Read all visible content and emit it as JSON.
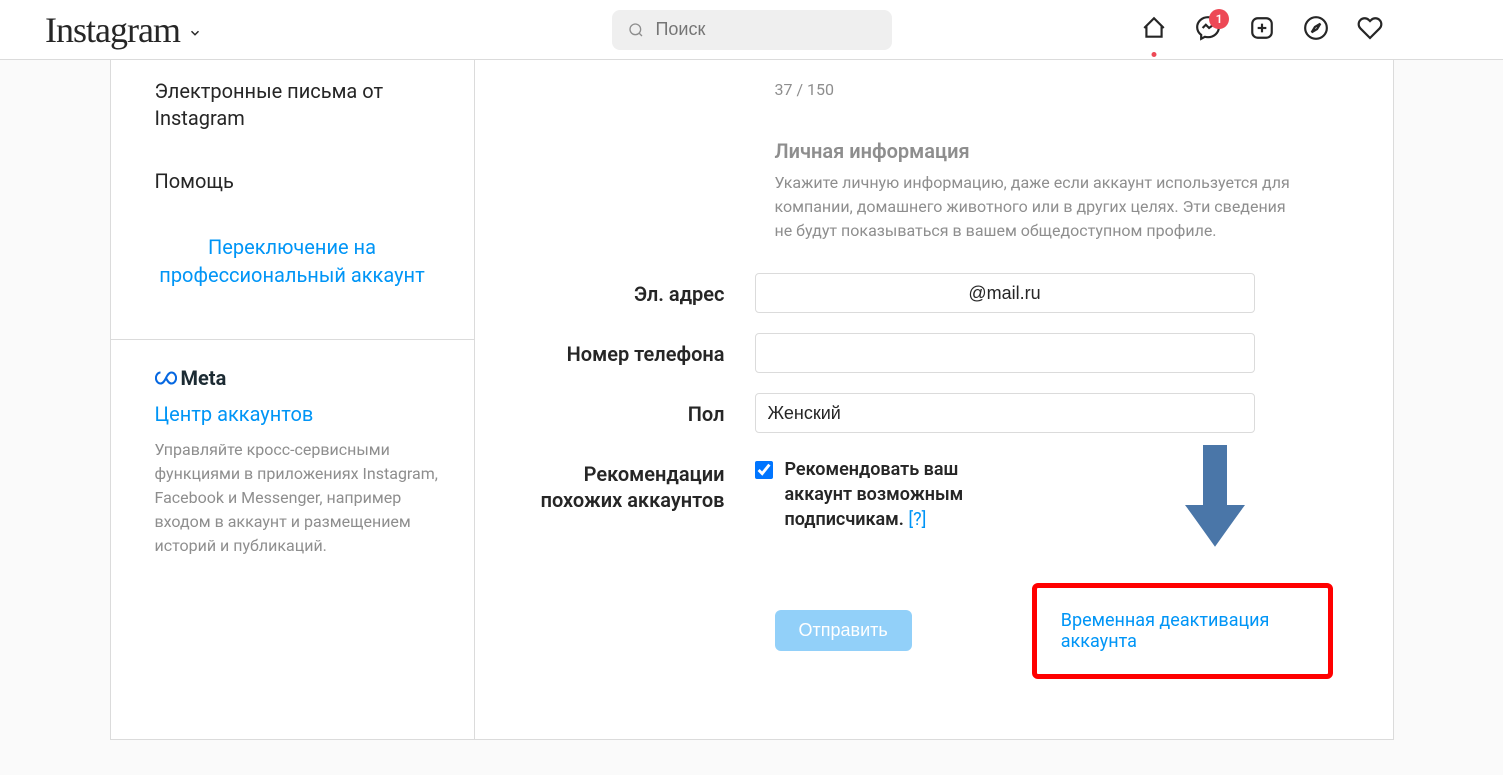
{
  "header": {
    "logo_text": "Instagram",
    "search_placeholder": "Поиск",
    "badge_count": "1"
  },
  "sidebar": {
    "items": [
      {
        "label": "Электронные письма от Instagram"
      },
      {
        "label": "Помощь"
      }
    ],
    "switch_link": "Переключение на профессиональный аккаунт",
    "meta": {
      "brand": "Meta",
      "accounts_center": "Центр аккаунтов",
      "description": "Управляйте кросс-сервисными функциями в приложениях Instagram, Facebook и Messenger, например входом в аккаунт и размещением историй и публикаций."
    }
  },
  "content": {
    "char_counter": "37 / 150",
    "personal_info_heading": "Личная информация",
    "personal_info_desc": "Укажите личную информацию, даже если аккаунт используется для компании, домашнего животного или в других целях. Эти сведения не будут показываться в вашем общедоступном профиле.",
    "labels": {
      "email": "Эл. адрес",
      "phone": "Номер телефона",
      "gender": "Пол",
      "similar": "Рекомендации похожих аккаунтов"
    },
    "values": {
      "email": "@mail.ru",
      "phone": "",
      "gender": "Женский"
    },
    "checkbox_label": "Рекомендовать ваш аккаунт возможным подписчикам. ",
    "help_marker": "[?]",
    "submit": "Отправить",
    "deactivate": "Временная деактивация аккаунта"
  }
}
